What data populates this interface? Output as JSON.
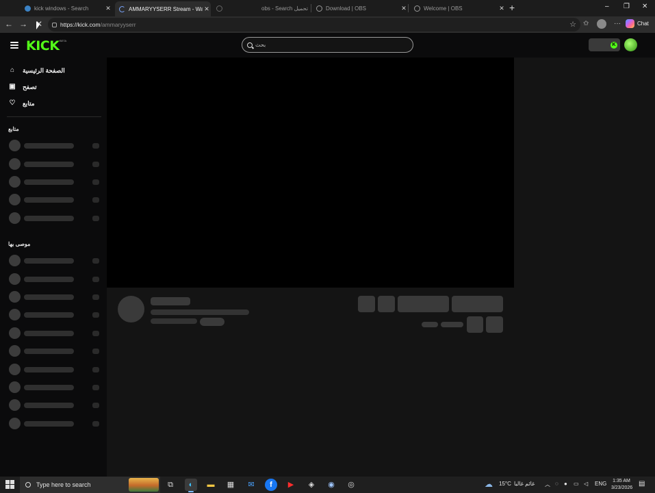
{
  "browser": {
    "tabs": [
      {
        "title": "kick windows - Search",
        "active": false
      },
      {
        "title": "AMMARYYSERR Stream - Watch L",
        "active": true
      },
      {
        "title": "",
        "active": false
      },
      {
        "title": "obs - Search تحميل",
        "active": false
      },
      {
        "title": "Download | OBS",
        "active": false
      },
      {
        "title": "Welcome | OBS",
        "active": false
      }
    ],
    "new_tab": "+",
    "window_controls": {
      "minimize": "–",
      "maximize": "❐",
      "close": "✕"
    },
    "address": {
      "host": "https://kick.com",
      "path": "/ammaryyserr"
    },
    "chat_label": "Chat"
  },
  "kick": {
    "logo": "KICK",
    "logo_beta": "BETA",
    "search_placeholder": "بحث",
    "nav": [
      {
        "label": "الصفحة الرئيسية",
        "icon": "home-icon",
        "glyph": "⌂"
      },
      {
        "label": "تصفح",
        "icon": "browse-icon",
        "glyph": "▣"
      },
      {
        "label": "متابع",
        "icon": "heart-icon",
        "glyph": "♡"
      }
    ],
    "sections": {
      "following": "متابع",
      "recommended": "موصى بها"
    },
    "live_badge": "K"
  },
  "taskbar": {
    "search_placeholder": "Type here to search",
    "weather_temp": "15°C",
    "weather_text": "غائم غالبا",
    "language": "ENG",
    "time": "1:35 AM",
    "date": "3/23/2026"
  }
}
